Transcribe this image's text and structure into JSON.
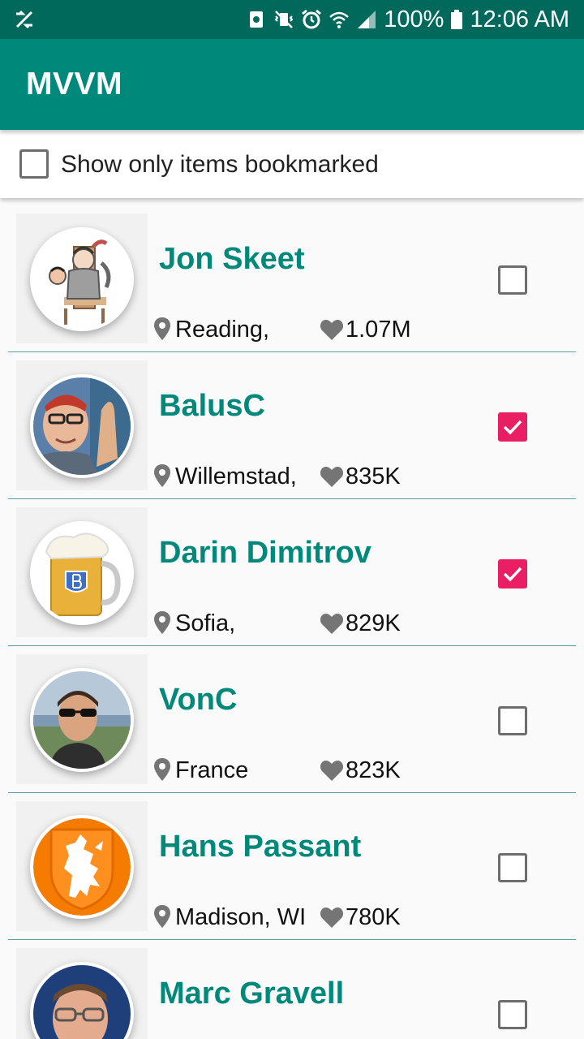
{
  "status_bar": {
    "battery_text": "100%",
    "time": "12:06 AM",
    "icons": [
      "no-sync-icon",
      "recycle-icon",
      "vibrate-off-icon",
      "alarm-icon",
      "wifi-icon",
      "signal-icon",
      "battery-icon"
    ]
  },
  "app_bar": {
    "title": "MVVM"
  },
  "filter": {
    "label": "Show only items bookmarked",
    "checked": false
  },
  "colors": {
    "status_bar": "#00695c",
    "app_bar": "#00897b",
    "name_text": "#00897b",
    "checkbox_checked": "#e91e63"
  },
  "users": [
    {
      "name": "Jon Skeet",
      "location": "Reading,",
      "reputation": "1.07M",
      "bookmarked": false,
      "avatar": "cartoon-avatar"
    },
    {
      "name": "BalusC",
      "location": "Willemstad,",
      "reputation": "835K",
      "bookmarked": true,
      "avatar": "photo-avatar"
    },
    {
      "name": "Darin Dimitrov",
      "location": "Sofia,",
      "reputation": "829K",
      "bookmarked": true,
      "avatar": "beer-avatar"
    },
    {
      "name": "VonC",
      "location": "France",
      "reputation": "823K",
      "bookmarked": false,
      "avatar": "photo-avatar"
    },
    {
      "name": "Hans Passant",
      "location": "Madison, WI",
      "reputation": "780K",
      "bookmarked": false,
      "avatar": "lion-crest-avatar"
    },
    {
      "name": "Marc Gravell",
      "location": "",
      "reputation": "",
      "bookmarked": false,
      "avatar": "photo-avatar"
    }
  ]
}
